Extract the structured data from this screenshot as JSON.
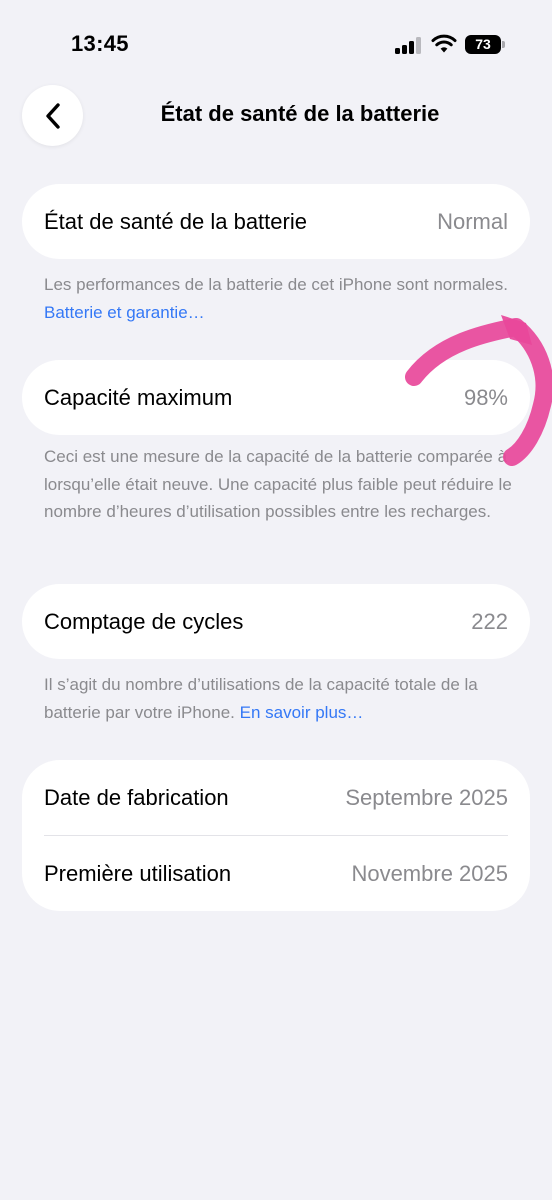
{
  "status_bar": {
    "time": "13:45",
    "battery_level": "73",
    "signal_bars": 3,
    "signal_bars_total": 4
  },
  "nav": {
    "title": "État de santé de la batterie",
    "back_icon": "chevron-left-icon"
  },
  "sections": {
    "health": {
      "label": "État de santé de la batterie",
      "value": "Normal",
      "footnote_text": "Les performances de la batterie de cet iPhone sont normales. ",
      "footnote_link": "Batterie et garantie…"
    },
    "capacity": {
      "label": "Capacité maximum",
      "value": "98%",
      "footnote_text": "Ceci est une mesure de la capacité de la batterie comparée à lorsqu’elle était neuve. Une capacité plus faible peut réduire le nombre d’heures d’utilisation possibles entre les recharges."
    },
    "cycles": {
      "label": "Comptage de cycles",
      "value": "222",
      "footnote_text": "Il s’agit du nombre d’utilisations de la capacité totale de la batterie par votre iPhone. ",
      "footnote_link": "En savoir plus…"
    },
    "dates": {
      "manufacture_label": "Date de fabrication",
      "manufacture_value": "Septembre 2025",
      "first_use_label": "Première utilisation",
      "first_use_value": "Novembre 2025"
    }
  },
  "colors": {
    "background": "#f2f2f7",
    "card": "#ffffff",
    "secondary_text": "#8a8a8e",
    "link": "#3478f6",
    "annotation": "#e8489a"
  }
}
